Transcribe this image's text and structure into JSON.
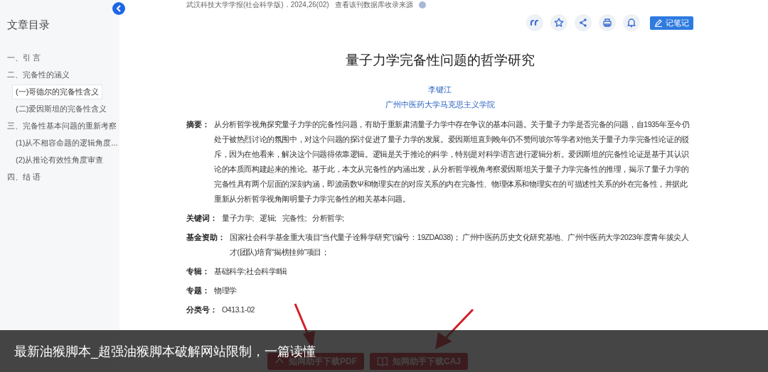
{
  "sidebar": {
    "title": "文章目录",
    "items": [
      {
        "label": "一、引 言",
        "selected": false
      },
      {
        "label": "二、完备性的涵义",
        "selected": false,
        "children": [
          {
            "label": "(一)哥德尔的完备性含义",
            "selected": true
          },
          {
            "label": "(二)爱因斯坦的完备性含义",
            "selected": false
          }
        ]
      },
      {
        "label": "三、完备性基本问题的重新考察",
        "selected": false,
        "children": [
          {
            "label": "(1)从不相容命题的逻辑角度...",
            "selected": false
          },
          {
            "label": "(2)从推论有效性角度审查",
            "selected": false
          }
        ]
      },
      {
        "label": "四、结 语",
        "selected": false
      }
    ]
  },
  "source": {
    "journal": "武汉科技大学学报(社会科学版)．2024,26(02)",
    "link": "查看该刊数据库收录来源"
  },
  "toolbar": {
    "note_button": "记笔记"
  },
  "article": {
    "title": "量子力学完备性问题的哲学研究",
    "author": "李键江",
    "affiliation": "广州中医药大学马克思主义学院",
    "fields": [
      {
        "label": "摘要：",
        "value": "从分析哲学视角探究量子力学的完备性问题，有助于重新肃清量子力学中存在争议的基本问题。关于量子力学是否完备的问题，自1935年至今仍处于被热烈讨论的氛围中，对这个问题的探讨促进了量子力学的发展。爱因斯坦直到晚年仍不赞同玻尔等学者对他关于量子力学完备性论证的驳斥，因为在他看来，解决这个问题得依靠逻辑。逻辑是关于推论的科学，特别是对科学语言进行逻辑分析。爱因斯坦的完备性论证是基于其认识论的本质而构建起来的推论。基于此，本文从完备性的内涵出发，从分析哲学视角考察爱因斯坦关于量子力学完备性的推理，揭示了量子力学的完备性具有两个层面的深刻内涵，即波函数Ψ和物理实在的对应关系的内在完备性、物理体系和物理实在的可描述性关系的外在完备性，并据此重新从分析哲学视角阐明量子力学完备性的相关基本问题。"
      },
      {
        "label": "关键词：",
        "keywords": [
          "量子力学;",
          "逻辑;",
          "完备性;",
          "分析哲学;"
        ]
      },
      {
        "label": "基金资助：",
        "value": "国家社会科学基金重大项目“当代量子诠释学研究”(编号：19ZDA038)； 广州中医药历史文化研究基地、广州中医药大学2023年度青年拔尖人才(团队)培育“揭榜挂帅”项目；"
      },
      {
        "label": "专辑：",
        "value": "基础科学;社会科学Ⅱ辑"
      },
      {
        "label": "专题：",
        "value": "物理学"
      },
      {
        "label": "分类号：",
        "value": "O413.1-02"
      }
    ],
    "downloads": [
      "知网助手下载PDF",
      "知网助手下载CAJ"
    ]
  },
  "caption": "最新油猴脚本_超强油猴脚本破解网站限制，一篇读懂"
}
